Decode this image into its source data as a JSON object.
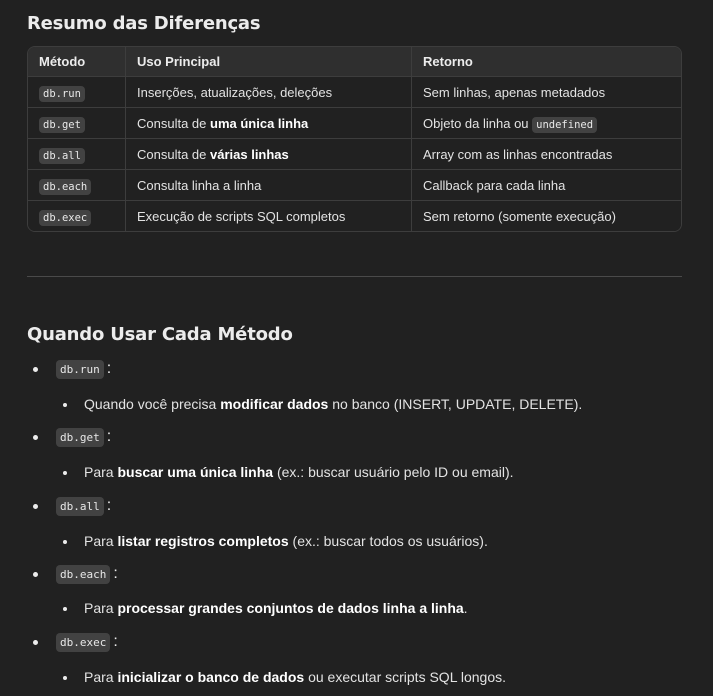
{
  "summary": {
    "title": "Resumo das Diferenças",
    "headers": [
      "Método",
      "Uso Principal",
      "Retorno"
    ],
    "rows": [
      {
        "method": "db.run",
        "use_pre": "Inserções, atualizações, deleções",
        "use_bold": "",
        "ret_pre": "Sem linhas, apenas metadados",
        "ret_code": ""
      },
      {
        "method": "db.get",
        "use_pre": "Consulta de ",
        "use_bold": "uma única linha",
        "ret_pre": "Objeto da linha ou ",
        "ret_code": "undefined"
      },
      {
        "method": "db.all",
        "use_pre": "Consulta de ",
        "use_bold": "várias linhas",
        "ret_pre": "Array com as linhas encontradas",
        "ret_code": ""
      },
      {
        "method": "db.each",
        "use_pre": "Consulta linha a linha",
        "use_bold": "",
        "ret_pre": "Callback para cada linha",
        "ret_code": ""
      },
      {
        "method": "db.exec",
        "use_pre": "Execução de scripts SQL completos",
        "use_bold": "",
        "ret_pre": "Sem retorno (somente execução)",
        "ret_code": ""
      }
    ]
  },
  "when": {
    "title": "Quando Usar Cada Método",
    "items": [
      {
        "method": "db.run",
        "pre": "Quando você precisa ",
        "bold": "modificar dados",
        "post": " no banco (INSERT, UPDATE, DELETE)."
      },
      {
        "method": "db.get",
        "pre": "Para ",
        "bold": "buscar uma única linha",
        "post": " (ex.: buscar usuário pelo ID ou email)."
      },
      {
        "method": "db.all",
        "pre": "Para ",
        "bold": "listar registros completos",
        "post": " (ex.: buscar todos os usuários)."
      },
      {
        "method": "db.each",
        "pre": "Para ",
        "bold": "processar grandes conjuntos de dados linha a linha",
        "post": "."
      },
      {
        "method": "db.exec",
        "pre": "Para ",
        "bold": "inicializar o banco de dados",
        "post": " ou executar scripts SQL longos."
      }
    ]
  }
}
